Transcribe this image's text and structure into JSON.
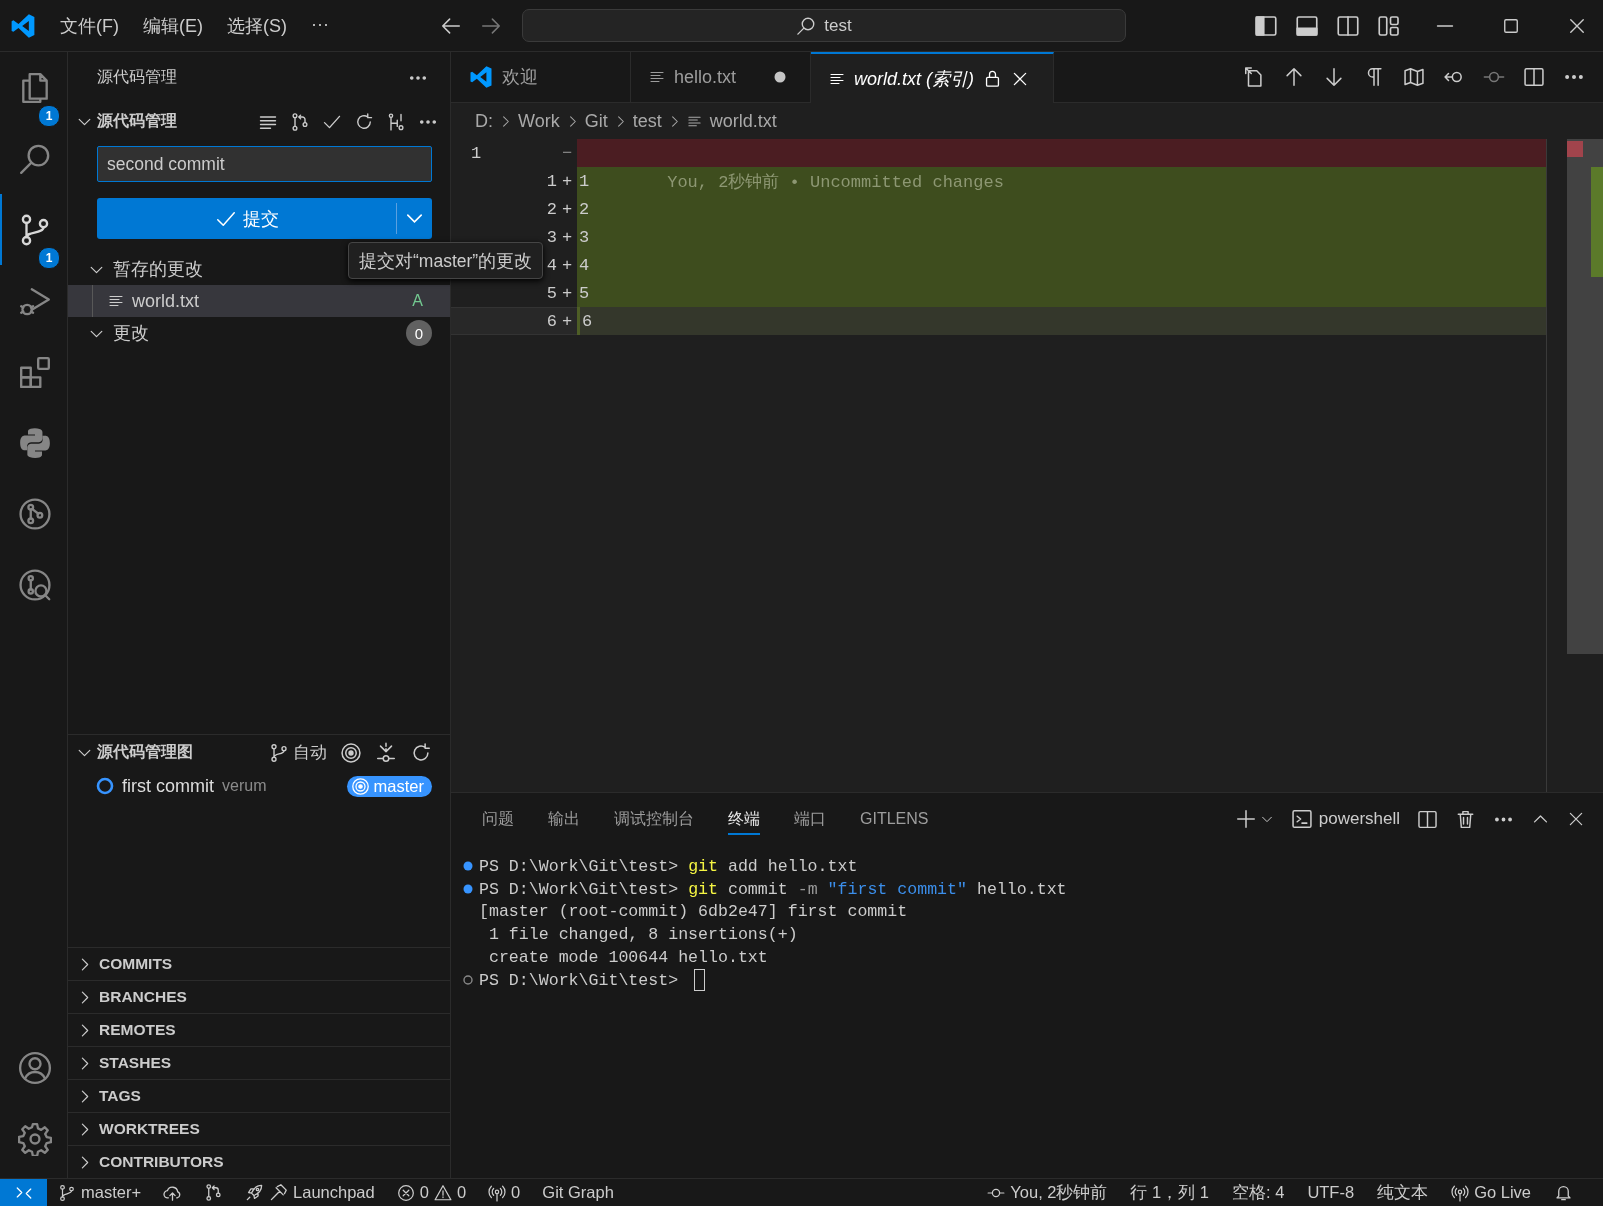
{
  "menu": [
    "文件(F)",
    "编辑(E)",
    "选择(S)",
    "···"
  ],
  "command_center": {
    "value": "test"
  },
  "activity_bar": {
    "items": [
      {
        "kind": "explorer",
        "badge": "1",
        "selected": false
      },
      {
        "kind": "search",
        "selected": false
      },
      {
        "kind": "scm",
        "badge": "1",
        "selected": true
      },
      {
        "kind": "debug",
        "selected": false
      },
      {
        "kind": "extensions",
        "selected": false
      },
      {
        "kind": "python",
        "selected": false
      },
      {
        "kind": "gitlens",
        "selected": false
      },
      {
        "kind": "gitlens_inspect",
        "selected": false
      }
    ],
    "bottom": [
      {
        "kind": "account"
      },
      {
        "kind": "settings"
      }
    ]
  },
  "sidebar": {
    "title": "源代码管理",
    "scm": {
      "title": "源代码管理",
      "expanded": true,
      "commit_message": "second commit",
      "commit_button": "提交",
      "tooltip": "提交对“master”的更改",
      "groups": [
        {
          "label": "暂存的更改",
          "expanded": true,
          "files": [
            {
              "name": "world.txt",
              "status": "A",
              "selected": true
            }
          ]
        },
        {
          "label": "更改",
          "expanded": true,
          "count": "0"
        }
      ]
    },
    "graph": {
      "title": "源代码管理图",
      "expanded": true,
      "mode": "自动",
      "commits": [
        {
          "message": "first commit",
          "author": "verum",
          "branch": "master"
        }
      ]
    },
    "sections": [
      {
        "label": "COMMITS",
        "expanded": false
      },
      {
        "label": "BRANCHES",
        "expanded": false
      },
      {
        "label": "REMOTES",
        "expanded": false
      },
      {
        "label": "STASHES",
        "expanded": false
      },
      {
        "label": "TAGS",
        "expanded": false
      },
      {
        "label": "WORKTREES",
        "expanded": false
      },
      {
        "label": "CONTRIBUTORS",
        "expanded": false
      }
    ]
  },
  "editor": {
    "tabs": [
      {
        "kind": "welcome",
        "label": "欢迎",
        "selected": false,
        "dirty": false,
        "preview": false,
        "readonly": false
      },
      {
        "kind": "file",
        "label": "hello.txt",
        "selected": false,
        "dirty": true,
        "preview": false,
        "readonly": false
      },
      {
        "kind": "file",
        "label": "world.txt (索引)",
        "selected": true,
        "dirty": false,
        "preview": true,
        "readonly": true
      }
    ],
    "breadcrumb": [
      "D:",
      "Work",
      "Git",
      "test",
      "world.txt"
    ],
    "lines": [
      {
        "kind": "removed",
        "original": "1",
        "sign": "−",
        "current": false
      },
      {
        "kind": "added",
        "modified": "1",
        "sign": "+",
        "text": "1",
        "blame": "You, 2秒钟前 • Uncommitted changes",
        "current": false
      },
      {
        "kind": "added",
        "modified": "2",
        "sign": "+",
        "text": "2",
        "current": false
      },
      {
        "kind": "added",
        "modified": "3",
        "sign": "+",
        "text": "3",
        "current": false
      },
      {
        "kind": "added",
        "modified": "4",
        "sign": "+",
        "text": "4",
        "current": false
      },
      {
        "kind": "added",
        "modified": "5",
        "sign": "+",
        "text": "5",
        "current": false
      },
      {
        "kind": "added",
        "modified": "6",
        "sign": "+",
        "text": "6",
        "current": true
      }
    ]
  },
  "panel": {
    "tabs": [
      {
        "label": "问题",
        "selected": false
      },
      {
        "label": "输出",
        "selected": false
      },
      {
        "label": "调试控制台",
        "selected": false
      },
      {
        "label": "终端",
        "selected": true
      },
      {
        "label": "端口",
        "selected": false
      },
      {
        "label": "GITLENS",
        "selected": false
      }
    ],
    "terminal_name": "powershell",
    "lines": [
      {
        "kind": "command_done",
        "segments": [
          {
            "kind": "plain",
            "text": "PS D:\\Work\\Git\\test> "
          },
          {
            "kind": "command",
            "text": "git"
          },
          {
            "kind": "plain",
            "text": " add hello.txt"
          }
        ]
      },
      {
        "kind": "command_done",
        "segments": [
          {
            "kind": "plain",
            "text": "PS D:\\Work\\Git\\test> "
          },
          {
            "kind": "command",
            "text": "git"
          },
          {
            "kind": "plain",
            "text": " commit "
          },
          {
            "kind": "flag",
            "text": "-m "
          },
          {
            "kind": "string",
            "text": "\"first commit\""
          },
          {
            "kind": "plain",
            "text": " hello.txt"
          }
        ]
      },
      {
        "kind": "output",
        "segments": [
          {
            "kind": "plain",
            "text": "[master (root-commit) 6db2e47] first commit"
          }
        ]
      },
      {
        "kind": "output",
        "segments": [
          {
            "kind": "plain",
            "text": " 1 file changed, 8 insertions(+)"
          }
        ]
      },
      {
        "kind": "output",
        "segments": [
          {
            "kind": "plain",
            "text": " create mode 100644 hello.txt"
          }
        ]
      },
      {
        "kind": "prompt",
        "segments": [
          {
            "kind": "plain",
            "text": "PS D:\\Work\\Git\\test> "
          }
        ],
        "cursor": true
      }
    ]
  },
  "status_bar": {
    "left": [
      {
        "kind": "branch",
        "text": "master+"
      },
      {
        "kind": "publish"
      },
      {
        "kind": "compare"
      },
      {
        "kind": "launchpad",
        "text": "Launchpad"
      },
      {
        "kind": "problems",
        "errors": "0",
        "warnings": "0"
      },
      {
        "kind": "ports",
        "text": "0"
      },
      {
        "kind": "plain",
        "text": "Git Graph"
      }
    ],
    "right": [
      {
        "kind": "blame",
        "text": "You, 2秒钟前"
      },
      {
        "kind": "plain",
        "text": "行 1，列 1"
      },
      {
        "kind": "plain",
        "text": "空格: 4"
      },
      {
        "kind": "plain",
        "text": "UTF-8"
      },
      {
        "kind": "plain",
        "text": "纯文本"
      },
      {
        "kind": "golive",
        "text": "Go Live"
      },
      {
        "kind": "bell"
      }
    ]
  }
}
